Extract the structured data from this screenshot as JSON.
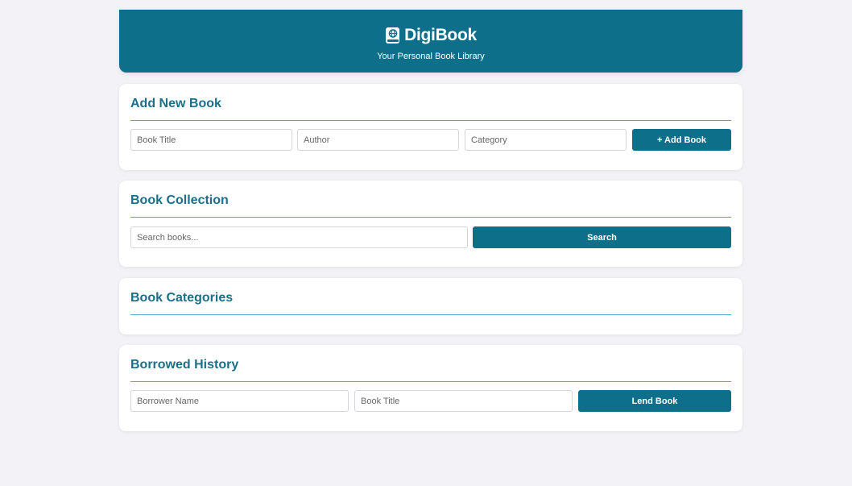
{
  "header": {
    "icon": "book-globe-icon",
    "brand": "DigiBook",
    "tagline": "Your Personal Book Library"
  },
  "add_book": {
    "title": "Add New Book",
    "title_placeholder": "Book Title",
    "author_placeholder": "Author",
    "category_placeholder": "Category",
    "add_label": "+ Add Book"
  },
  "collection": {
    "title": "Book Collection",
    "search_placeholder": "Search books...",
    "search_label": "Search"
  },
  "categories": {
    "title": "Book Categories"
  },
  "borrowed": {
    "title": "Borrowed History",
    "borrower_placeholder": "Borrower Name",
    "book_placeholder": "Book Title",
    "lend_label": "Lend Book"
  },
  "colors": {
    "primary": "#0e6f8a",
    "heading": "#1b6f88",
    "background": "#f2f2f7"
  }
}
